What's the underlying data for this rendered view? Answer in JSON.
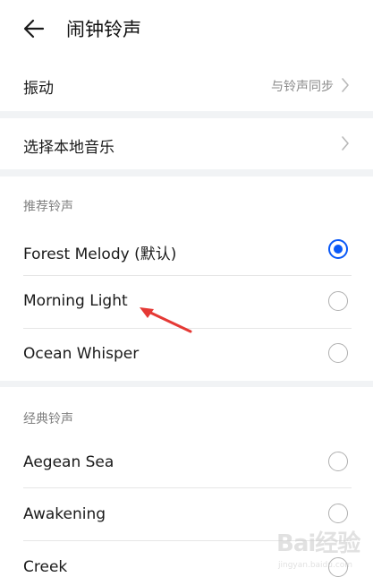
{
  "header": {
    "title": "闹钟铃声",
    "back_icon": "back-arrow-icon"
  },
  "vibration": {
    "label": "振动",
    "value": "与铃声同步"
  },
  "local_music": {
    "label": "选择本地音乐"
  },
  "recommended": {
    "title": "推荐铃声",
    "items": [
      {
        "label": "Forest Melody (默认)",
        "selected": true
      },
      {
        "label": "Morning Light",
        "selected": false
      },
      {
        "label": "Ocean Whisper",
        "selected": false
      }
    ]
  },
  "classic": {
    "title": "经典铃声",
    "items": [
      {
        "label": "Aegean Sea",
        "selected": false
      },
      {
        "label": "Awakening",
        "selected": false
      },
      {
        "label": "Creek",
        "selected": false
      }
    ]
  },
  "colors": {
    "accent": "#0a59f7",
    "annotation_arrow": "#e53935"
  },
  "watermark": {
    "logo": "Bai经验",
    "url": "jingyan.baidu.com"
  }
}
